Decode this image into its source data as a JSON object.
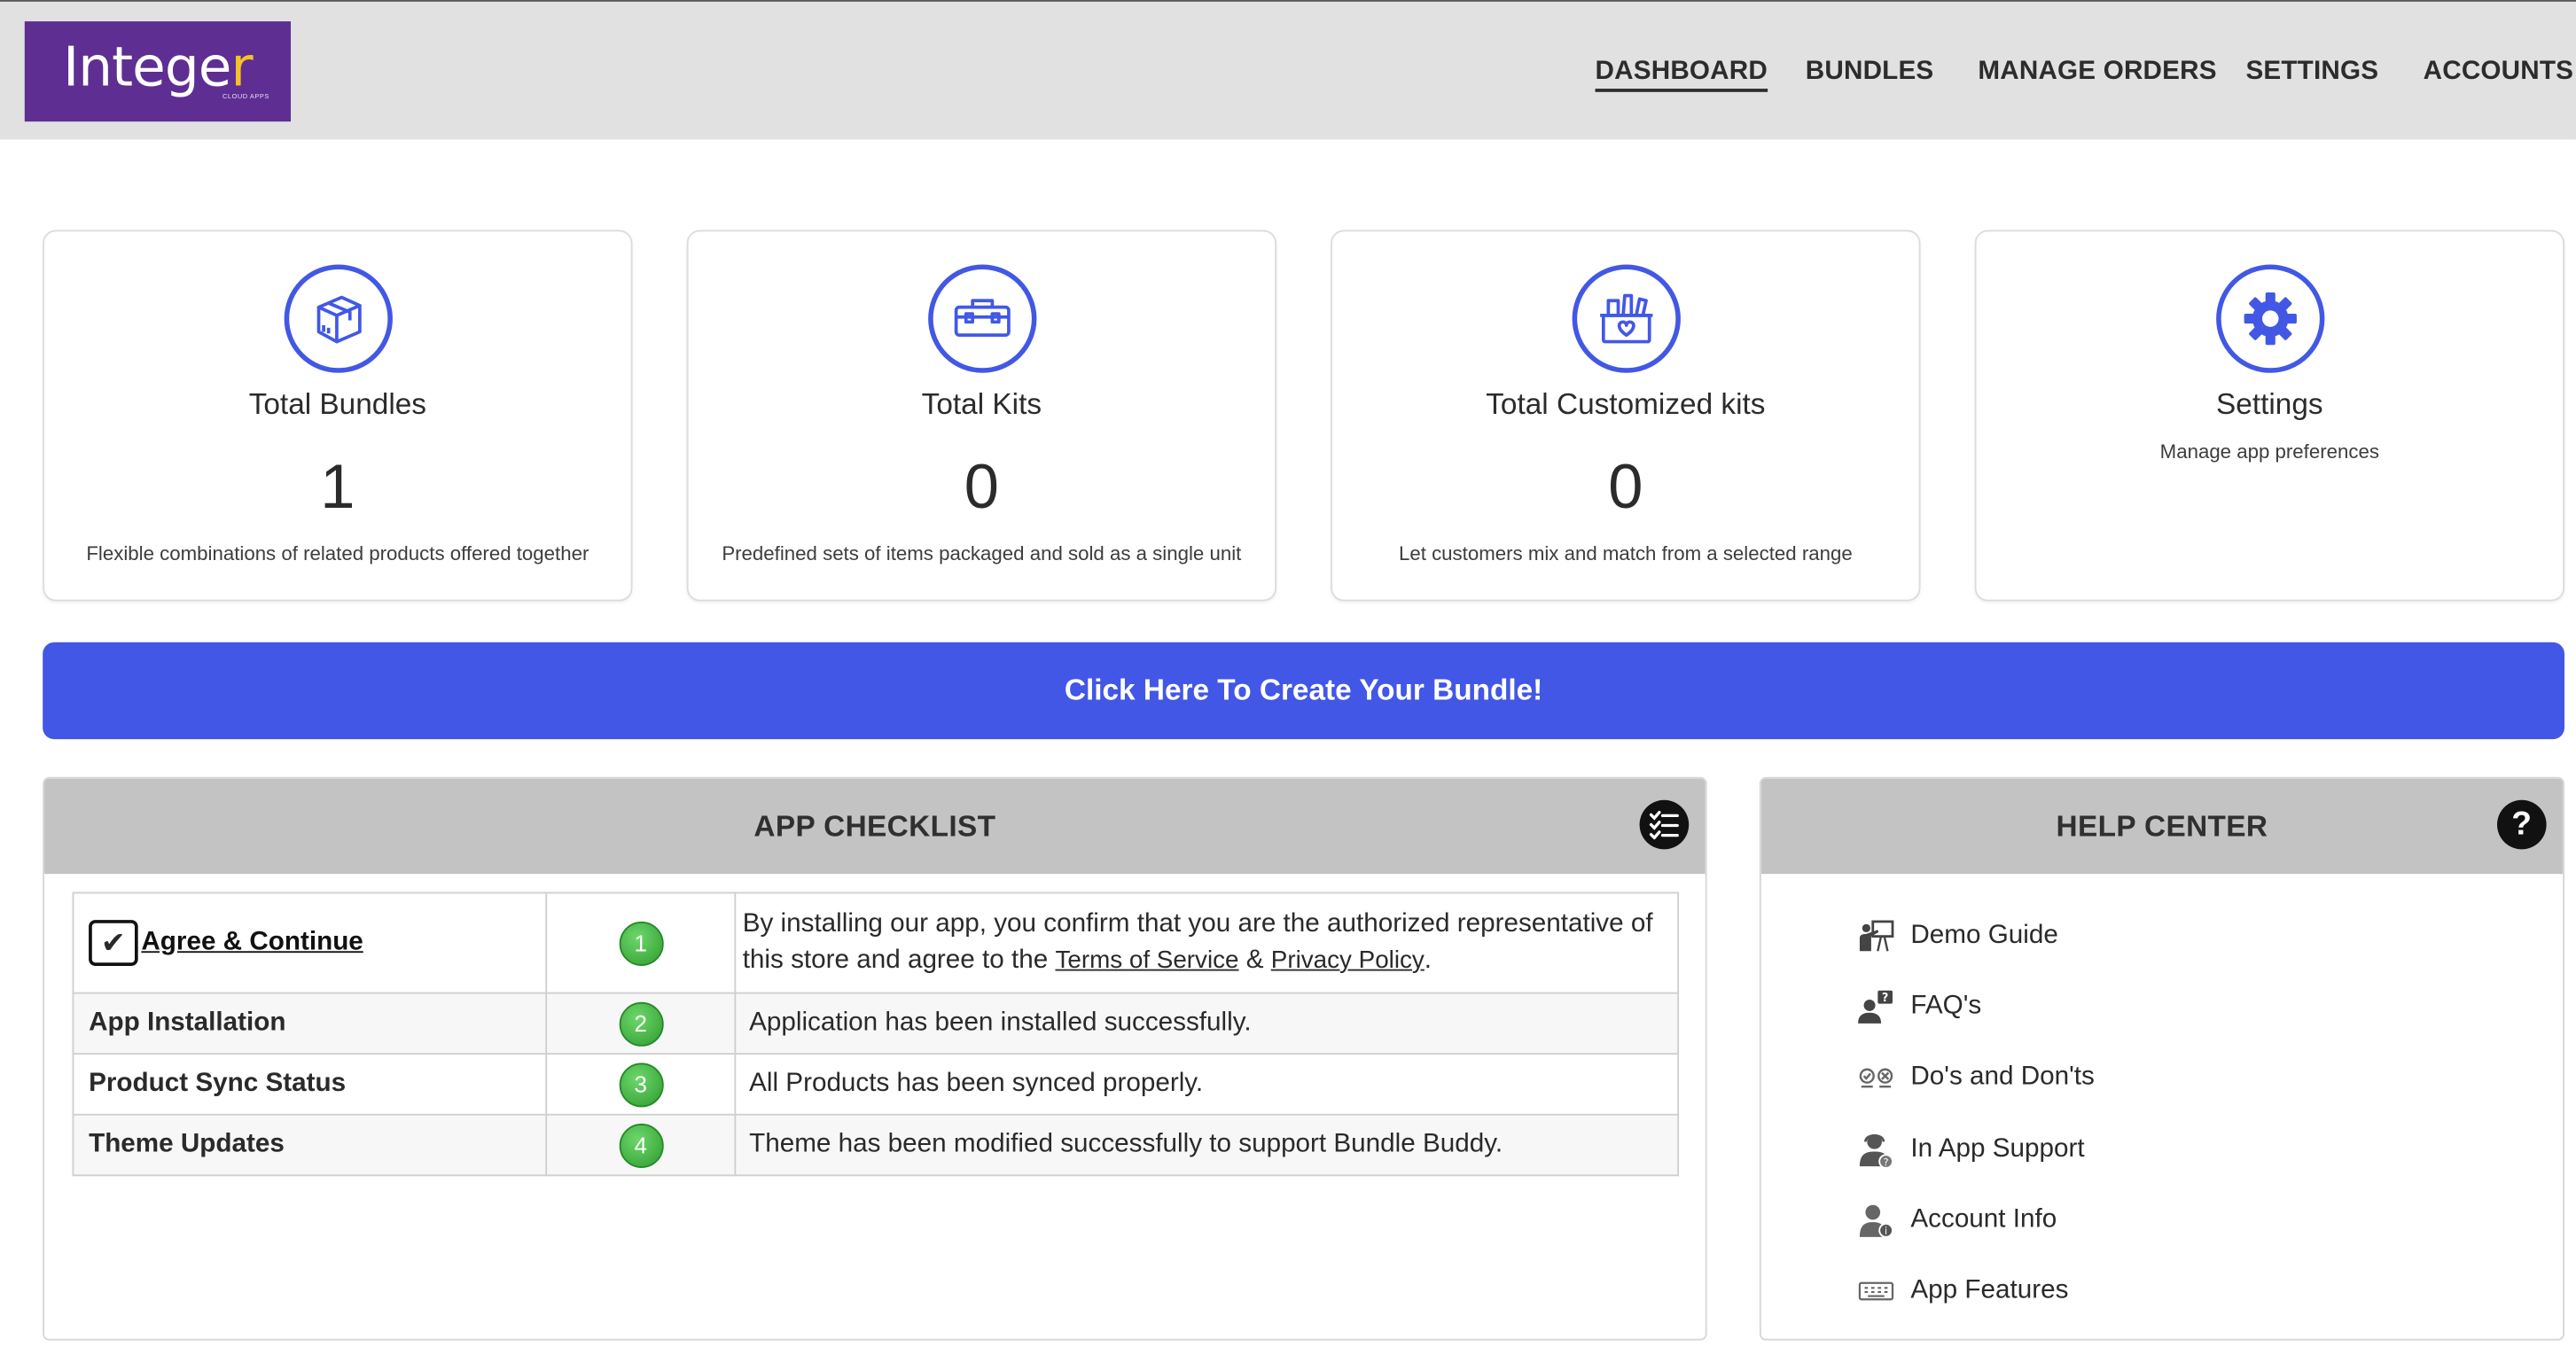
{
  "brand": {
    "name_main": "Intege",
    "name_accent": "r",
    "tagline": "CLOUD APPS",
    "bg_color": "#5e2e93",
    "accent_color": "#f5c325"
  },
  "nav": {
    "items": [
      {
        "label": "DASHBOARD",
        "active": true
      },
      {
        "label": "BUNDLES"
      },
      {
        "label": "MANAGE ORDERS"
      },
      {
        "label": "SETTINGS"
      },
      {
        "label": "ACCOUNTS"
      }
    ]
  },
  "cards": [
    {
      "icon": "box-icon",
      "title": "Total Bundles",
      "value": "1",
      "description": "Flexible combinations of related products offered together"
    },
    {
      "icon": "toolbox-icon",
      "title": "Total Kits",
      "value": "0",
      "description": "Predefined sets of items packaged and sold as a single unit"
    },
    {
      "icon": "gift-basket-icon",
      "title": "Total Customized kits",
      "value": "0",
      "description": "Let customers mix and match from a selected range"
    },
    {
      "icon": "gear-icon",
      "title": "Settings",
      "subtitle": "Manage app preferences"
    }
  ],
  "cta": {
    "label": "Click Here To Create Your Bundle!",
    "color": "#4257e6"
  },
  "checklist": {
    "title": "APP CHECKLIST",
    "icon": "checklist-icon",
    "agree": {
      "checkbox": "✔",
      "label": "Agree & Continue",
      "step": "1",
      "text_before": "By installing our app, you confirm that you are the authorized representative of this store and agree to the",
      "terms_link": "Terms of Service",
      "amp": "&",
      "privacy_link": "Privacy Policy",
      "text_end": "."
    },
    "rows": [
      {
        "label": "App Installation",
        "step": "2",
        "status": "Application has been installed successfully."
      },
      {
        "label": "Product Sync Status",
        "step": "3",
        "status": "All Products has been synced properly."
      },
      {
        "label": "Theme Updates",
        "step": "4",
        "status": "Theme has been modified successfully to support Bundle Buddy."
      }
    ],
    "step_color": "#3aa83a"
  },
  "help_center": {
    "title": "HELP CENTER",
    "icon": "question-icon",
    "items": [
      {
        "label": "Demo Guide",
        "icon": "presenter-icon"
      },
      {
        "label": "FAQ's",
        "icon": "faq-person-icon"
      },
      {
        "label": "Do's and Don'ts",
        "icon": "dos-donts-icon"
      },
      {
        "label": "In App Support",
        "icon": "support-agent-icon"
      },
      {
        "label": "Account Info",
        "icon": "account-info-icon"
      },
      {
        "label": "App Features",
        "icon": "features-keyboard-icon"
      }
    ]
  }
}
